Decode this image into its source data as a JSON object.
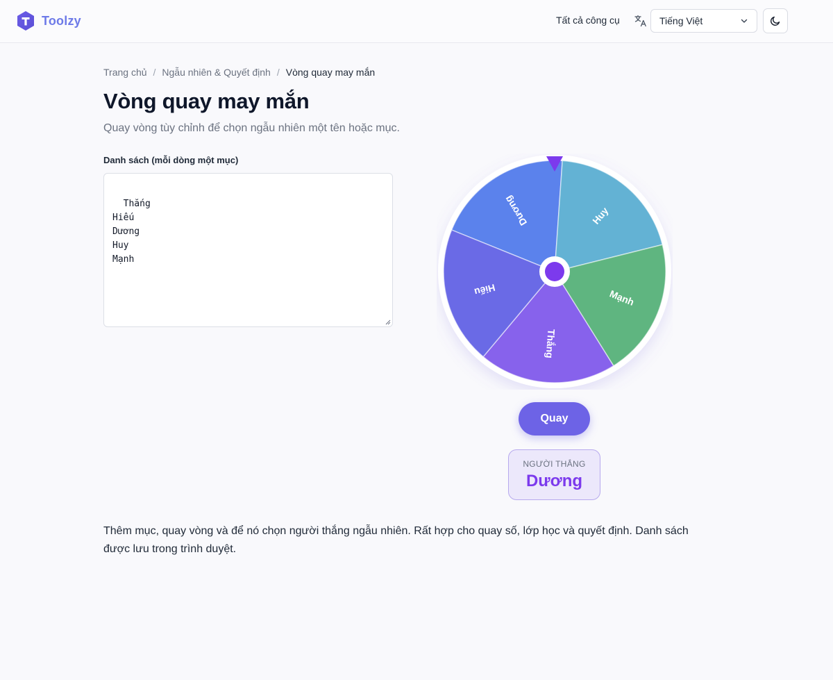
{
  "header": {
    "brand": "Toolzy",
    "all_tools": "Tất cả công cụ",
    "language": "Tiếng Việt",
    "icons": {
      "logo": "hexagon-t-logo",
      "translate": "translate-icon",
      "chevron": "chevron-down-icon",
      "theme": "moon-icon"
    }
  },
  "breadcrumb": {
    "items": [
      "Trang chủ",
      "Ngẫu nhiên & Quyết định",
      "Vòng quay may mắn"
    ],
    "separator": "/"
  },
  "page": {
    "title": "Vòng quay may mắn",
    "subtitle": "Quay vòng tùy chỉnh để chọn ngẫu nhiên một tên hoặc mục."
  },
  "list": {
    "label": "Danh sách (mỗi dòng một mục)",
    "value": "Thắng\nHiếu\nDương\nHuy\nMạnh"
  },
  "wheel": {
    "segments": [
      {
        "label": "Dương",
        "color": "#5b82ec"
      },
      {
        "label": "Huy",
        "color": "#63b2d4"
      },
      {
        "label": "Mạnh",
        "color": "#5fb580"
      },
      {
        "label": "Thắng",
        "color": "#8762ec"
      },
      {
        "label": "Hiếu",
        "color": "#6a6ae6"
      }
    ],
    "pointer_color": "#7c3aed",
    "hub_color": "#7c3aed"
  },
  "spin_button": "Quay",
  "winner": {
    "label": "NGƯỜI THẮNG",
    "name": "Dương"
  },
  "description": "Thêm mục, quay vòng và để nó chọn người thắng ngẫu nhiên. Rất hợp cho quay số, lớp học và quyết định. Danh sách được lưu trong trình duyệt.",
  "colors": {
    "accent": "#6d63e6",
    "brand_text": "#6d7ae8",
    "winner_bg": "#ece8fb",
    "winner_text": "#7c3aed"
  }
}
